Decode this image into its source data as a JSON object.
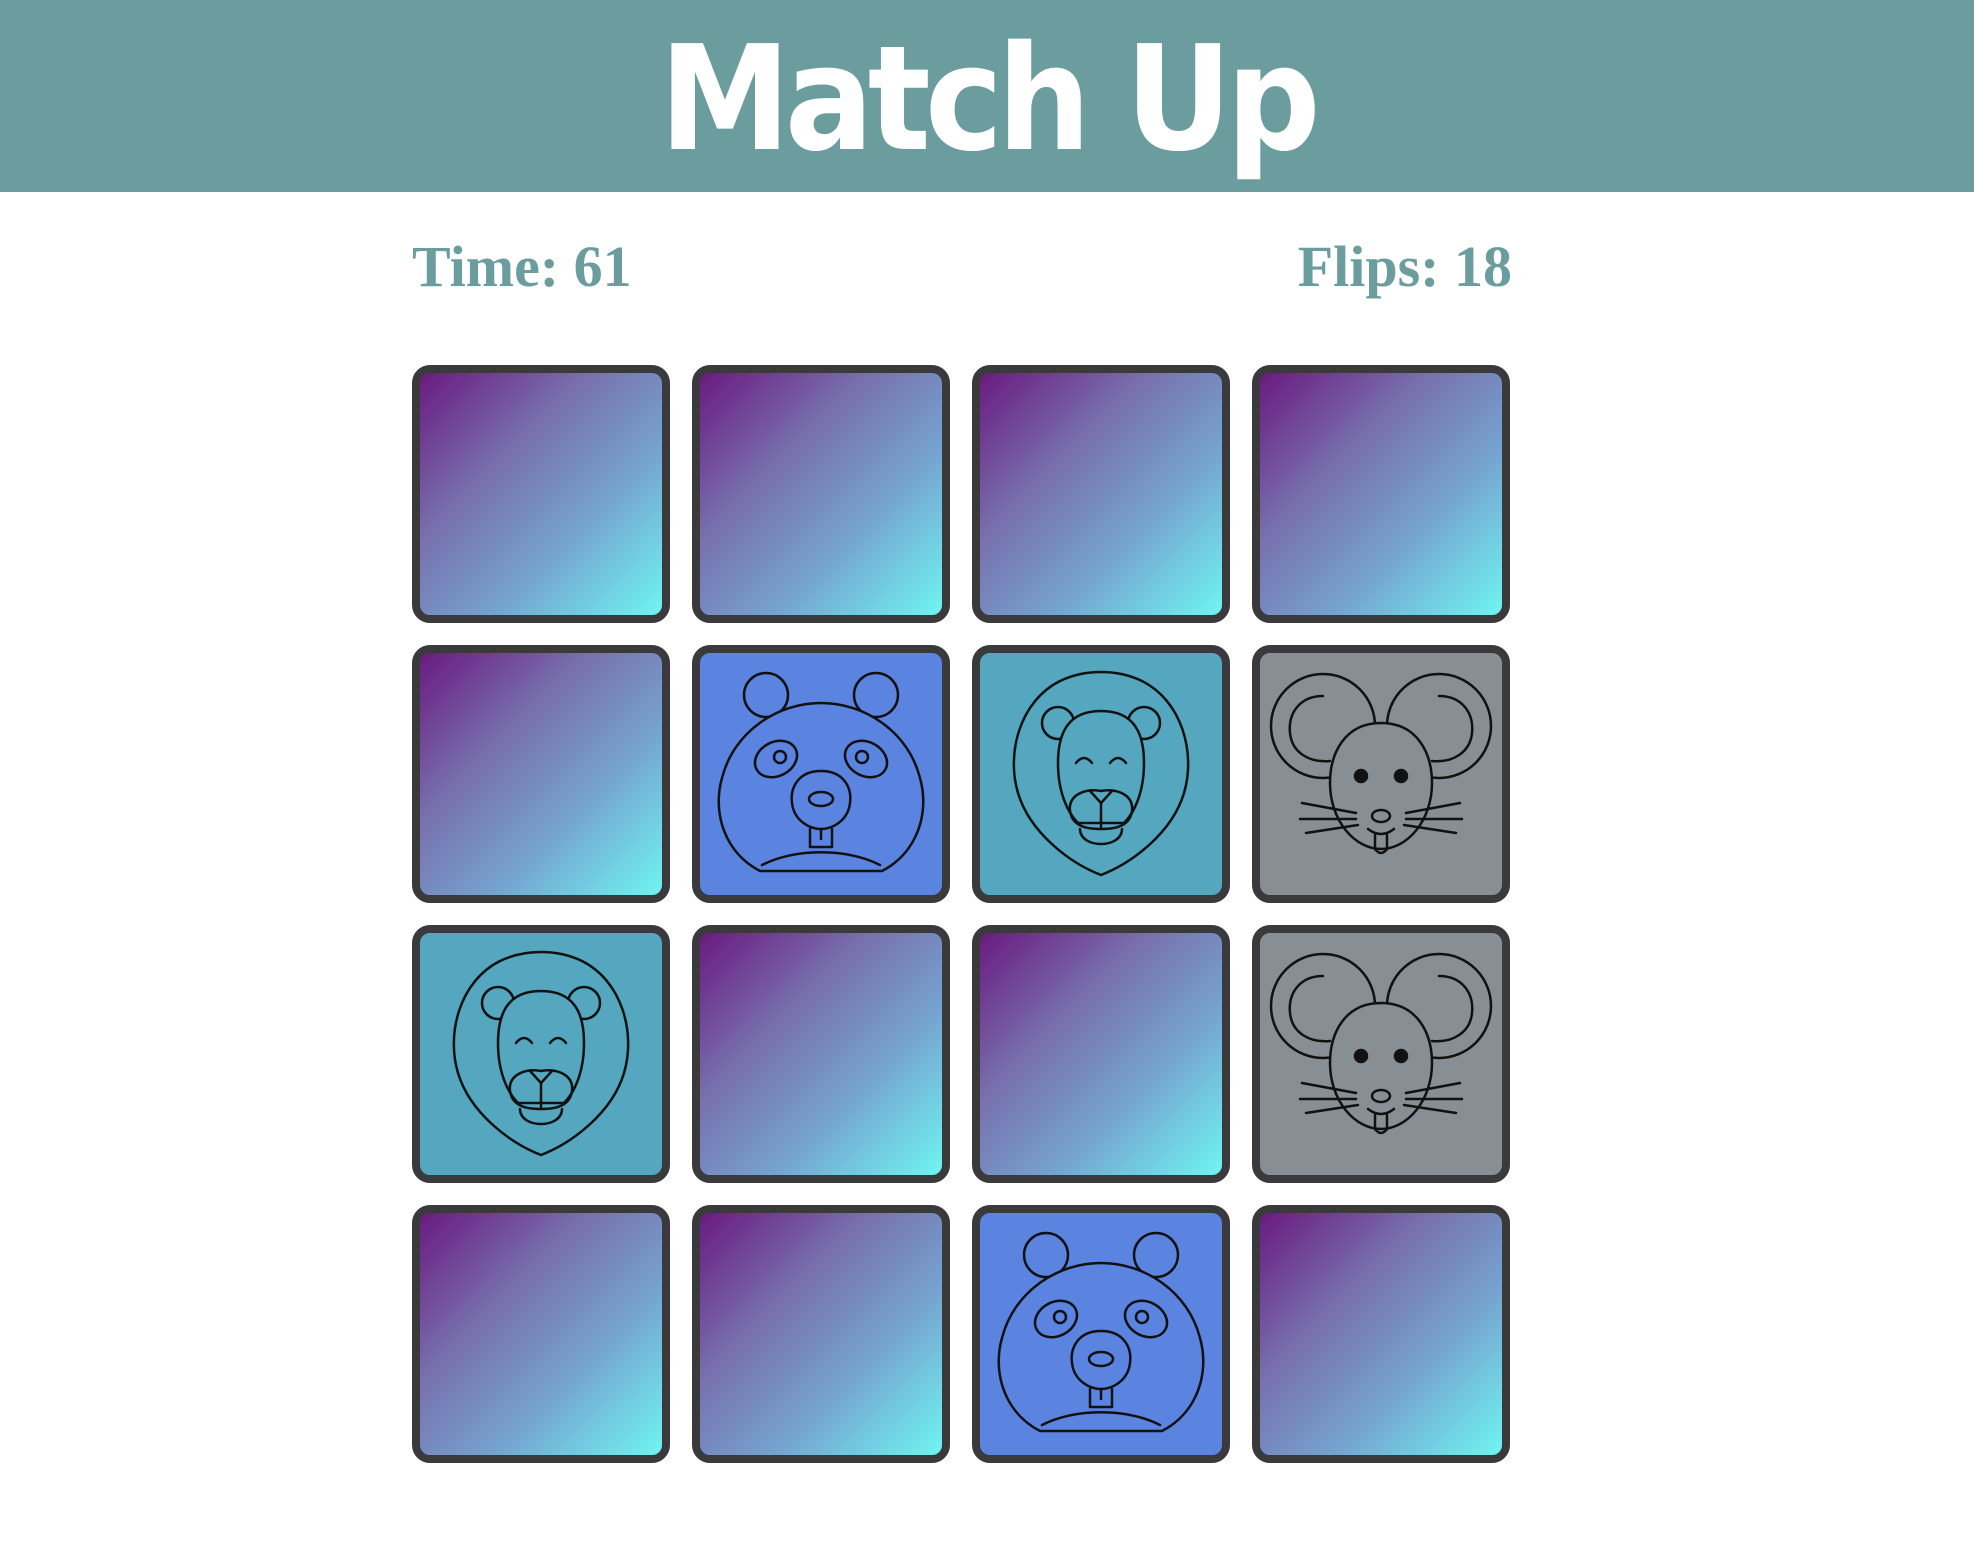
{
  "header": {
    "title": "Match Up",
    "color": "#6b9d9f"
  },
  "stats": {
    "time_label": "Time: 61",
    "time_value": 61,
    "flips_label": "Flips: 18",
    "flips_value": 18
  },
  "board": {
    "rows": 4,
    "cols": 4,
    "card_back": "gradient-purple-cyan",
    "cards": [
      {
        "face": "hidden"
      },
      {
        "face": "hidden"
      },
      {
        "face": "hidden"
      },
      {
        "face": "hidden"
      },
      {
        "face": "hidden"
      },
      {
        "face": "panda-icon",
        "color": "#5b84e0"
      },
      {
        "face": "lion-icon",
        "color": "#54a7bf"
      },
      {
        "face": "mouse-icon",
        "color": "#878f94"
      },
      {
        "face": "lion-icon",
        "color": "#54a7bf"
      },
      {
        "face": "hidden"
      },
      {
        "face": "hidden"
      },
      {
        "face": "mouse-icon",
        "color": "#878f94"
      },
      {
        "face": "hidden"
      },
      {
        "face": "hidden"
      },
      {
        "face": "panda-icon",
        "color": "#5b84e0"
      },
      {
        "face": "hidden"
      }
    ]
  }
}
